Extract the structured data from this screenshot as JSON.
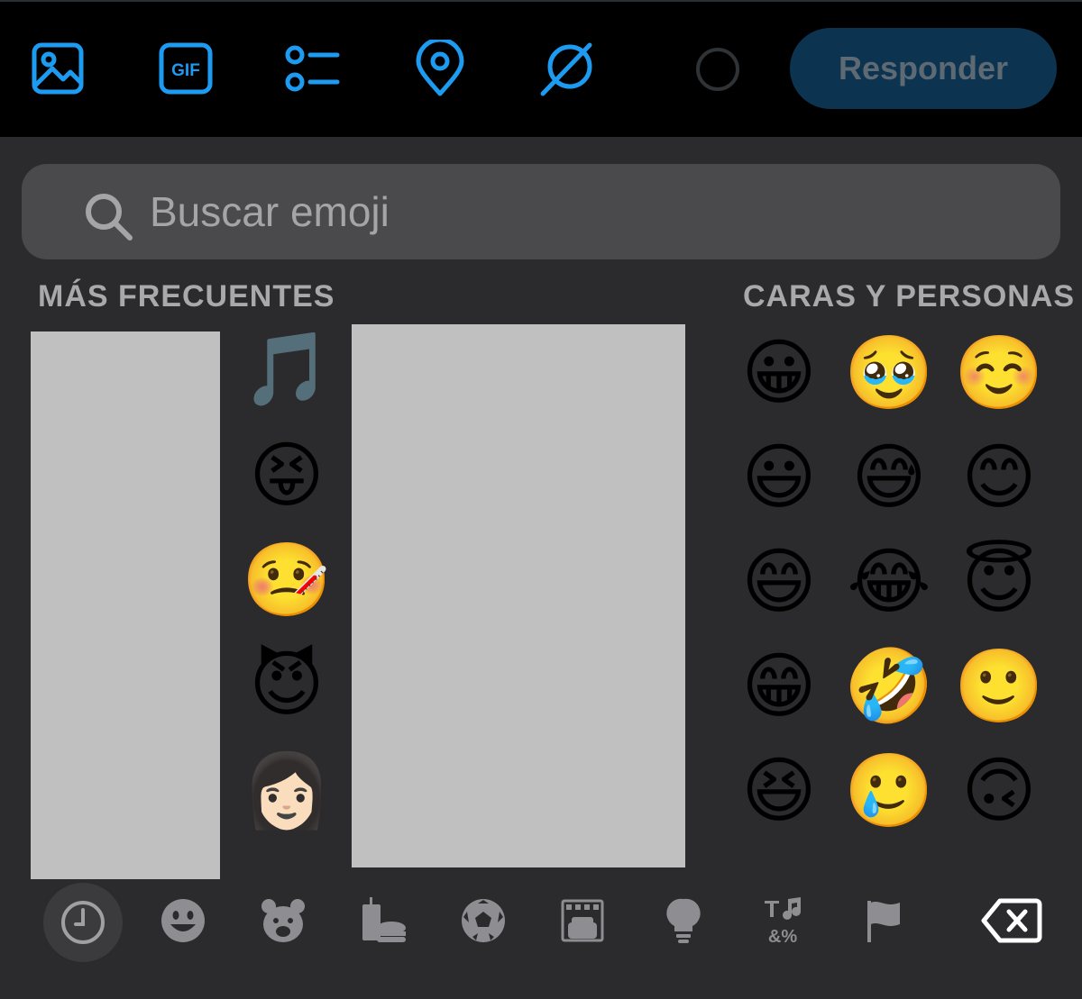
{
  "toolbar": {
    "icons": [
      "image-icon",
      "gif-icon",
      "poll-icon",
      "location-icon",
      "no-circle-icon"
    ],
    "gif_label": "GIF",
    "reply_label": "Responder",
    "accent": "#1d9bf0"
  },
  "emoji_search": {
    "placeholder": "Buscar emoji"
  },
  "sections": {
    "frequent_title": "MÁS FRECUENTES",
    "faces_title": "CARAS Y PERSONAS"
  },
  "frequent_emojis": [
    "🎵",
    "😝",
    "🤒",
    "😈",
    "👩🏻"
  ],
  "faces_emojis": [
    [
      "😀",
      "🥹",
      "☺️"
    ],
    [
      "😃",
      "😅",
      "😊"
    ],
    [
      "😄",
      "😂",
      "😇"
    ],
    [
      "😁",
      "🤣",
      "🙂"
    ],
    [
      "😆",
      "🥲",
      "🙃"
    ]
  ],
  "categories": [
    "recent-icon",
    "smileys-icon",
    "animals-icon",
    "food-icon",
    "activity-icon",
    "travel-icon",
    "objects-icon",
    "symbols-icon",
    "flags-icon"
  ],
  "symbols_label": "&%"
}
